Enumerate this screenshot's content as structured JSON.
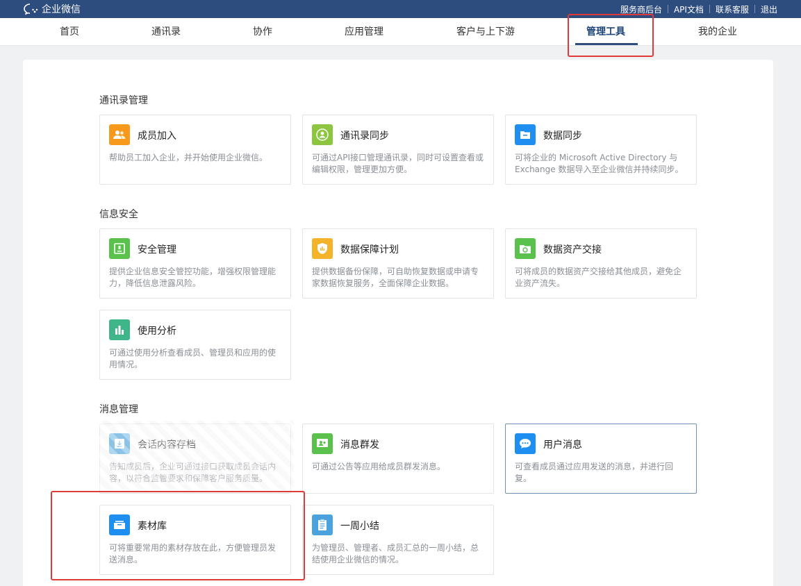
{
  "topbar": {
    "brand": "企业微信",
    "links": [
      "服务商后台",
      "API文档",
      "联系客服",
      "退出"
    ]
  },
  "nav": {
    "items": [
      "首页",
      "通讯录",
      "协作",
      "应用管理",
      "客户与上下游",
      "管理工具",
      "我的企业"
    ],
    "active": "管理工具"
  },
  "sections": [
    {
      "title": "通讯录管理",
      "cards": [
        {
          "title": "成员加入",
          "desc": "帮助员工加入企业，并开始使用企业微信。",
          "icon": "member-join-icon",
          "color": "#f79a1b"
        },
        {
          "title": "通讯录同步",
          "desc": "可通过API接口管理通讯录，同时可设置查看或编辑权限，管理更加方便。",
          "icon": "contact-sync-icon",
          "color": "#8cc63f"
        },
        {
          "title": "数据同步",
          "desc": "可将企业的 Microsoft Active Directory 与 Exchange 数据导入至企业微信并持续同步。",
          "icon": "data-sync-icon",
          "color": "#1e8ff0"
        }
      ]
    },
    {
      "title": "信息安全",
      "cards": [
        {
          "title": "安全管理",
          "desc": "提供企业信息安全管控功能，增强权限管理能力，降低信息泄露风险。",
          "icon": "security-icon",
          "color": "#59c14c"
        },
        {
          "title": "数据保障计划",
          "desc": "提供数据备份保障，可自助恢复数据或申请专家数据恢复服务，全面保障企业数据。",
          "icon": "data-protection-icon",
          "color": "#f3b32a"
        },
        {
          "title": "数据资产交接",
          "desc": "可将成员的数据资产交接给其他成员，避免企业资产流失。",
          "icon": "asset-handover-icon",
          "color": "#59c14c"
        },
        {
          "title": "使用分析",
          "desc": "可通过使用分析查看成员、管理员和应用的使用情况。",
          "icon": "usage-analysis-icon",
          "color": "#3fb58a"
        }
      ]
    },
    {
      "title": "消息管理",
      "cards": [
        {
          "title": "会话内容存档",
          "desc": "告知成员后，企业可通过接口获取成员会话内容，以符合监管要求和保障客户服务质量。",
          "icon": "archive-icon",
          "color": "#4aa3df"
        },
        {
          "title": "消息群发",
          "desc": "可通过公告等应用给成员群发消息。",
          "icon": "mass-message-icon",
          "color": "#59c14c"
        },
        {
          "title": "用户消息",
          "desc": "可查看成员通过应用发送的消息，并进行回复。",
          "icon": "user-message-icon",
          "color": "#1e8ff0"
        },
        {
          "title": "素材库",
          "desc": "可将重要常用的素材存放在此，方便管理员发送消息。",
          "icon": "material-library-icon",
          "color": "#1e8ff0"
        },
        {
          "title": "一周小结",
          "desc": "为管理员、管理者、成员汇总的一周小结，总结使用企业微信的情况。",
          "icon": "weekly-summary-icon",
          "color": "#4aa3df"
        }
      ]
    }
  ]
}
